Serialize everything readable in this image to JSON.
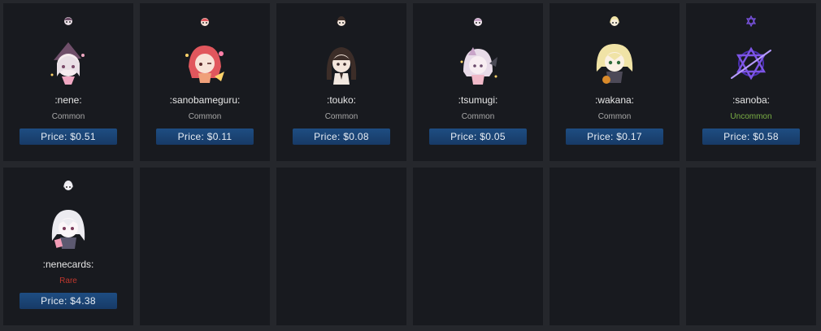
{
  "colors": {
    "common": "#a9a9a9",
    "uncommon": "#7bb045",
    "rare": "#c0372d"
  },
  "cards": [
    {
      "name": ":nene:",
      "rarity": "Common",
      "price": "Price: $0.51",
      "icon": "nene-emote-icon",
      "palette": [
        "#e9dfe6",
        "#6f4f6a",
        "#f0a8c2"
      ]
    },
    {
      "name": ":sanobameguru:",
      "rarity": "Common",
      "price": "Price: $0.11",
      "icon": "sanobameguru-emote-icon",
      "palette": [
        "#f0a07a",
        "#e1575d",
        "#ffd36a"
      ]
    },
    {
      "name": ":touko:",
      "rarity": "Common",
      "price": "Price: $0.08",
      "icon": "touko-emote-icon",
      "palette": [
        "#3c2d28",
        "#f2e8e0",
        "#cfa58e"
      ]
    },
    {
      "name": ":tsumugi:",
      "rarity": "Common",
      "price": "Price: $0.05",
      "icon": "tsumugi-emote-icon",
      "palette": [
        "#e8dbe8",
        "#c9a5c9",
        "#f0b9c8"
      ]
    },
    {
      "name": ":wakana:",
      "rarity": "Common",
      "price": "Price: $0.17",
      "icon": "wakana-emote-icon",
      "palette": [
        "#f0e3a6",
        "#d98a2a",
        "#4d4a58"
      ]
    },
    {
      "name": ":sanoba:",
      "rarity": "Uncommon",
      "price": "Price: $0.58",
      "icon": "sanoba-hexagram-icon",
      "palette": [
        "#7d55e6",
        "#4a2fb0",
        "#b69bff"
      ]
    },
    {
      "name": ":nenecards:",
      "rarity": "Rare",
      "price": "Price: $4.38",
      "icon": "nenecards-emote-icon",
      "palette": [
        "#ecebf0",
        "#5c5970",
        "#f29cb6"
      ]
    }
  ]
}
